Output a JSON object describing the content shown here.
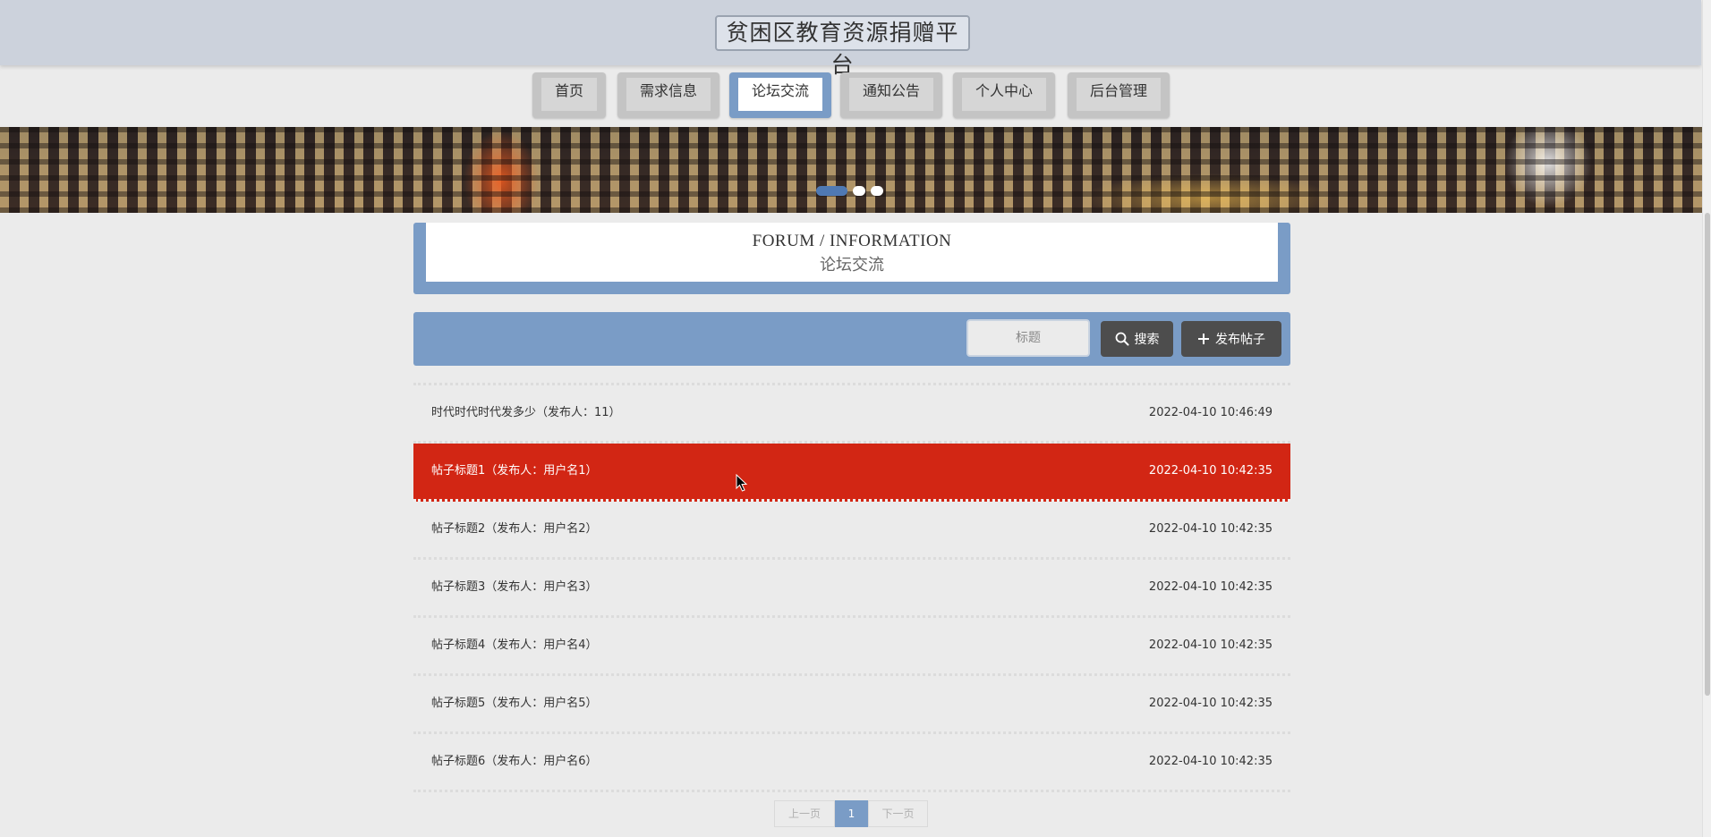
{
  "header": {
    "title": "贫困区教育资源捐赠平台"
  },
  "nav": {
    "items": [
      {
        "label": "首页"
      },
      {
        "label": "需求信息"
      },
      {
        "label": "论坛交流"
      },
      {
        "label": "通知公告"
      },
      {
        "label": "个人中心"
      },
      {
        "label": "后台管理"
      }
    ],
    "active_index": 2
  },
  "banner": {
    "active_slide": 1,
    "slide_count": 3
  },
  "section": {
    "title_en": "FORUM / INFORMATION",
    "title_cn": "论坛交流"
  },
  "toolbar": {
    "search_placeholder": "标题",
    "search_label": "搜索",
    "add_label": "发布帖子"
  },
  "posts": [
    {
      "title": "时代时代时代发多少（发布人：11）",
      "time": "2022-04-10 10:46:49"
    },
    {
      "title": "帖子标题1（发布人：用户名1）",
      "time": "2022-04-10 10:42:35"
    },
    {
      "title": "帖子标题2（发布人：用户名2）",
      "time": "2022-04-10 10:42:35"
    },
    {
      "title": "帖子标题3（发布人：用户名3）",
      "time": "2022-04-10 10:42:35"
    },
    {
      "title": "帖子标题4（发布人：用户名4）",
      "time": "2022-04-10 10:42:35"
    },
    {
      "title": "帖子标题5（发布人：用户名5）",
      "time": "2022-04-10 10:42:35"
    },
    {
      "title": "帖子标题6（发布人：用户名6）",
      "time": "2022-04-10 10:42:35"
    }
  ],
  "pagination": {
    "prev_label": "上一页",
    "current_page": "1",
    "next_label": "下一页"
  },
  "colors": {
    "accent_blue": "#7a9cc6",
    "highlight_red": "#d22614",
    "button_dark": "#4d4d4d"
  }
}
